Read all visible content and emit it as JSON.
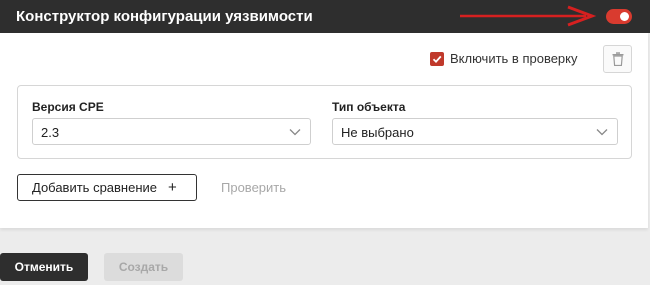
{
  "header": {
    "title": "Конструктор конфигурации уязвимости",
    "toggle_state": "on",
    "accent_color": "#d93b2f"
  },
  "panel": {
    "include_checkbox": {
      "label": "Включить в проверку",
      "checked": true
    },
    "delete_icon": "trash-icon",
    "fields": {
      "cpe_version": {
        "label": "Версия CPE",
        "value": "2.3"
      },
      "object_type": {
        "label": "Тип объекта",
        "value": "Не выбрано"
      }
    },
    "add_comparison_label": "Добавить сравнение",
    "add_comparison_icon": "plus-icon",
    "check_label": "Проверить"
  },
  "footer": {
    "cancel_label": "Отменить",
    "create_label": "Создать"
  }
}
